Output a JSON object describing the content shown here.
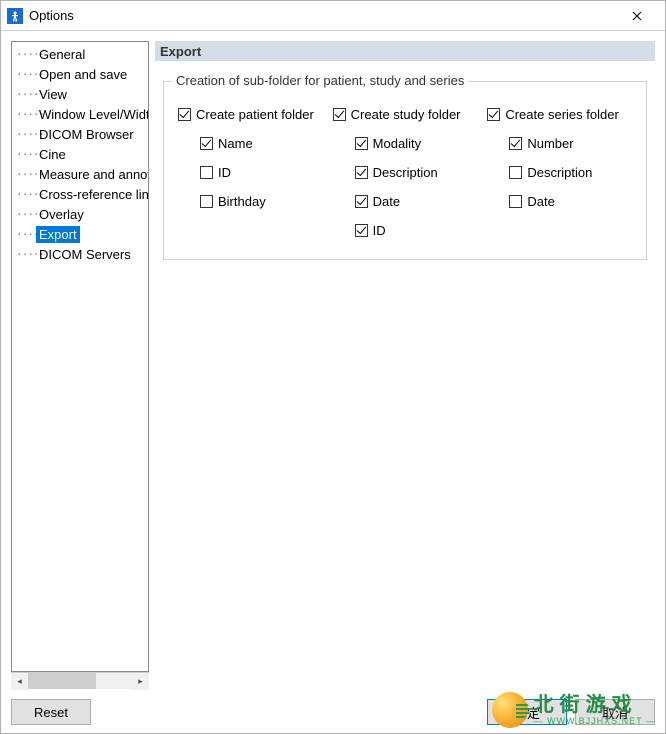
{
  "window": {
    "title": "Options"
  },
  "tree": {
    "items": [
      {
        "label": "General"
      },
      {
        "label": "Open and save"
      },
      {
        "label": "View"
      },
      {
        "label": "Window Level/Width"
      },
      {
        "label": "DICOM Browser"
      },
      {
        "label": "Cine"
      },
      {
        "label": "Measure and annotation"
      },
      {
        "label": "Cross-reference line"
      },
      {
        "label": "Overlay"
      },
      {
        "label": "Export",
        "selected": true
      },
      {
        "label": "DICOM Servers"
      }
    ]
  },
  "page": {
    "title": "Export",
    "fieldset_legend": "Creation of sub-folder for patient, study and series",
    "cols": [
      {
        "heading": {
          "label": "Create patient folder",
          "checked": true
        },
        "items": [
          {
            "label": "Name",
            "checked": true
          },
          {
            "label": "ID",
            "checked": false
          },
          {
            "label": "Birthday",
            "checked": false
          }
        ]
      },
      {
        "heading": {
          "label": "Create study folder",
          "checked": true
        },
        "items": [
          {
            "label": "Modality",
            "checked": true
          },
          {
            "label": "Description",
            "checked": true
          },
          {
            "label": "Date",
            "checked": true
          },
          {
            "label": "ID",
            "checked": true
          }
        ]
      },
      {
        "heading": {
          "label": "Create series folder",
          "checked": true
        },
        "items": [
          {
            "label": "Number",
            "checked": true
          },
          {
            "label": "Description",
            "checked": false
          },
          {
            "label": "Date",
            "checked": false
          }
        ]
      }
    ]
  },
  "buttons": {
    "reset": "Reset",
    "ok": "确定",
    "cancel": "取消"
  },
  "watermark": {
    "cn": "北街游戏",
    "en": "— WWW.BJJHXS.NET —"
  }
}
